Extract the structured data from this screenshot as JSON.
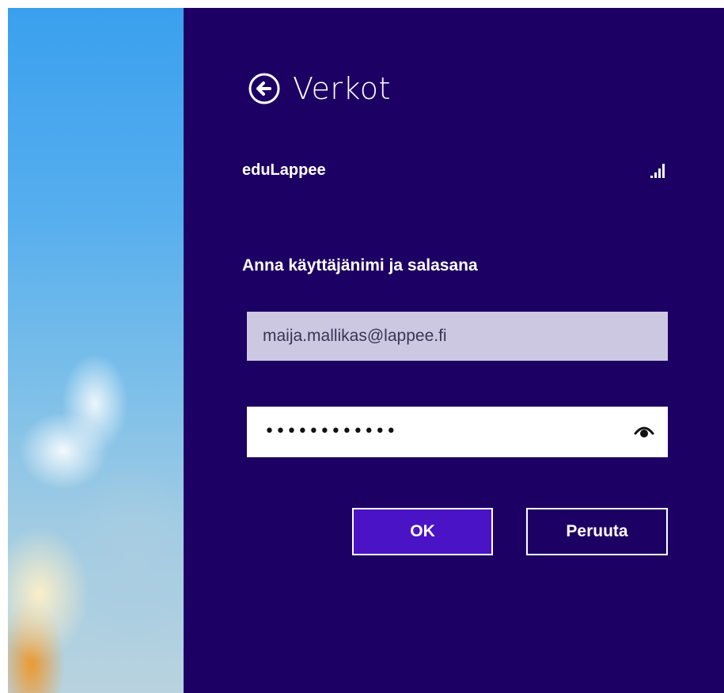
{
  "panel": {
    "title": "Verkot",
    "back_icon": "arrow-left-circle-icon",
    "background_color": "#1d0063"
  },
  "network": {
    "name": "eduLappee",
    "signal_icon": "wifi-signal-bars-icon"
  },
  "form": {
    "prompt": "Anna käyttäjänimi ja salasana",
    "username_value": "maija.mallikas@lappee.fi",
    "password_masked": "••••••••••••",
    "reveal_icon": "eye-reveal-icon"
  },
  "buttons": {
    "ok_label": "OK",
    "cancel_label": "Peruuta",
    "accent_color": "#4a13c6"
  }
}
